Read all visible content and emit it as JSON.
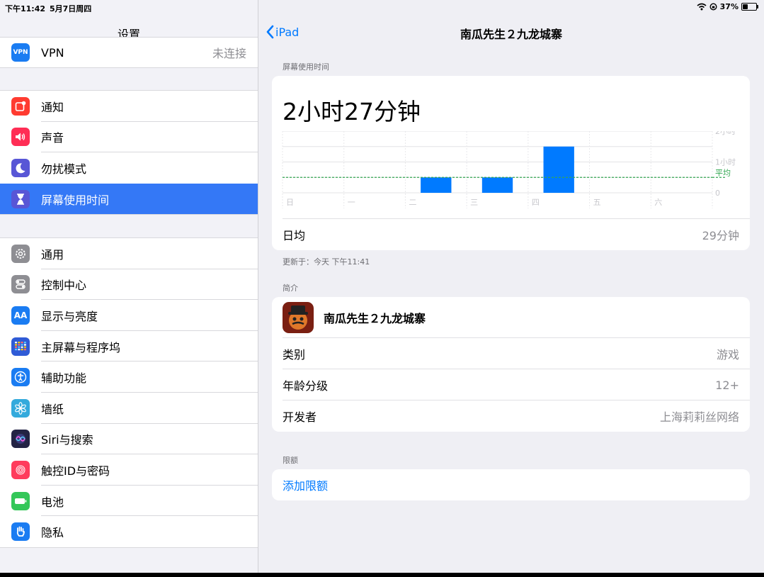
{
  "status_bar": {
    "time": "下午11:42",
    "date": "5月7日周四",
    "battery": "37%",
    "battery_level": 0.37
  },
  "sidebar": {
    "title": "设置",
    "vpn": {
      "label": "VPN",
      "value": "未连接",
      "color": "#1a7cf2"
    },
    "group1": [
      {
        "name": "notifications",
        "label": "通知",
        "color": "#ff3b30",
        "icon": "notification-icon"
      },
      {
        "name": "sounds",
        "label": "声音",
        "color": "#ff2d55",
        "icon": "speaker-icon"
      },
      {
        "name": "dnd",
        "label": "勿扰模式",
        "color": "#5856d6",
        "icon": "moon-icon"
      },
      {
        "name": "screen-time",
        "label": "屏幕使用时间",
        "color": "#5856d6",
        "icon": "hourglass-icon",
        "selected": true
      }
    ],
    "group2": [
      {
        "name": "general",
        "label": "通用",
        "color": "#8e8e93",
        "icon": "gear-icon"
      },
      {
        "name": "control-center",
        "label": "控制中心",
        "color": "#8e8e93",
        "icon": "toggles-icon"
      },
      {
        "name": "display",
        "label": "显示与亮度",
        "color": "#1a7cf2",
        "icon": "text-size-icon",
        "glyph": "AA"
      },
      {
        "name": "home-screen",
        "label": "主屏幕与程序坞",
        "color": "#2f5bd6",
        "icon": "grid-icon"
      },
      {
        "name": "accessibility",
        "label": "辅助功能",
        "color": "#1a7cf2",
        "icon": "accessibility-icon"
      },
      {
        "name": "wallpaper",
        "label": "墙纸",
        "color": "#34aadc",
        "icon": "flower-icon"
      },
      {
        "name": "siri",
        "label": "Siri与搜索",
        "color": "#232344",
        "icon": "siri-icon"
      },
      {
        "name": "touch-id",
        "label": "触控ID与密码",
        "color": "#ff3b5c",
        "icon": "fingerprint-icon"
      },
      {
        "name": "battery",
        "label": "电池",
        "color": "#34c759",
        "icon": "battery-icon"
      },
      {
        "name": "privacy",
        "label": "隐私",
        "color": "#1a7cf2",
        "icon": "hand-icon"
      }
    ]
  },
  "detail": {
    "back_label": "iPad",
    "title": "南瓜先生２九龙城寨",
    "screen_time_header": "屏幕使用时间",
    "total_time": "2小时27分钟",
    "daily_avg_label": "日均",
    "daily_avg_value": "29分钟",
    "updated": "更新于：今天 下午11:41",
    "info_header": "简介",
    "app_name": "南瓜先生２九龙城寨",
    "category_label": "类别",
    "category_value": "游戏",
    "age_label": "年龄分级",
    "age_value": "12+",
    "developer_label": "开发者",
    "developer_value": "上海莉莉丝网络",
    "limits_header": "限额",
    "add_limit": "添加限额"
  },
  "chart_data": {
    "type": "bar",
    "categories": [
      "日",
      "一",
      "二",
      "三",
      "四",
      "五",
      "六"
    ],
    "values": [
      0,
      0,
      0.5,
      0.5,
      1.5,
      0,
      0
    ],
    "y_unit": "hours",
    "ylim": [
      0,
      2
    ],
    "y_ticks": [
      "2小时",
      "1小时",
      "0"
    ],
    "average": 0.5,
    "average_label": "平均",
    "bar_color": "#007aff",
    "avg_color": "#34a853"
  }
}
